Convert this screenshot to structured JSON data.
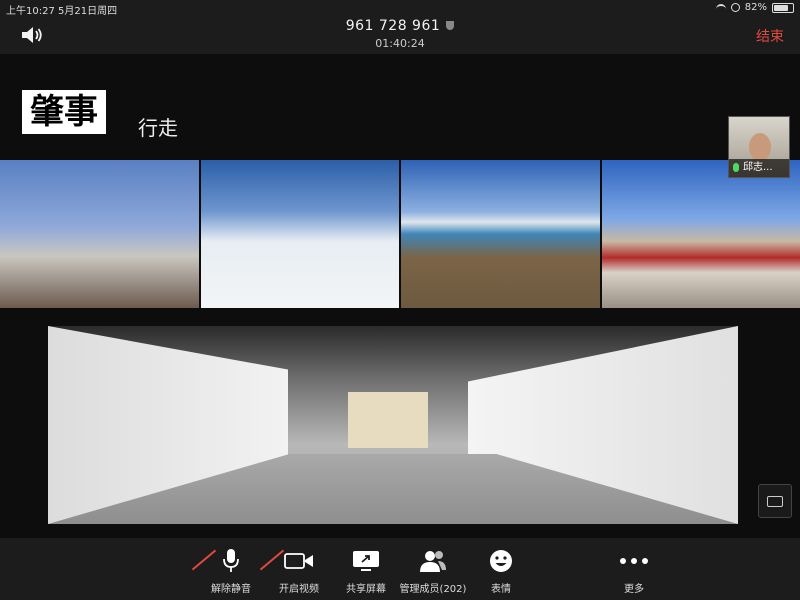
{
  "status": {
    "time": "上午10:27",
    "date": "5月21日周四",
    "battery": "82%",
    "battery_level": 0.82
  },
  "meeting": {
    "id": "961 728 961",
    "duration": "01:40:24",
    "end_label": "结束"
  },
  "share": {
    "brand": "肇事",
    "subtitle": "行走"
  },
  "participant": {
    "name": "邱志..."
  },
  "toolbar": {
    "unmute": "解除静音",
    "video": "开启视频",
    "share_screen": "共享屏幕",
    "participants": "管理成员(202)",
    "reactions": "表情",
    "more": "更多"
  },
  "colors": {
    "accent_red": "#e04a3f",
    "mic_green": "#4cd964",
    "bar_bg": "#1c1c1c"
  }
}
